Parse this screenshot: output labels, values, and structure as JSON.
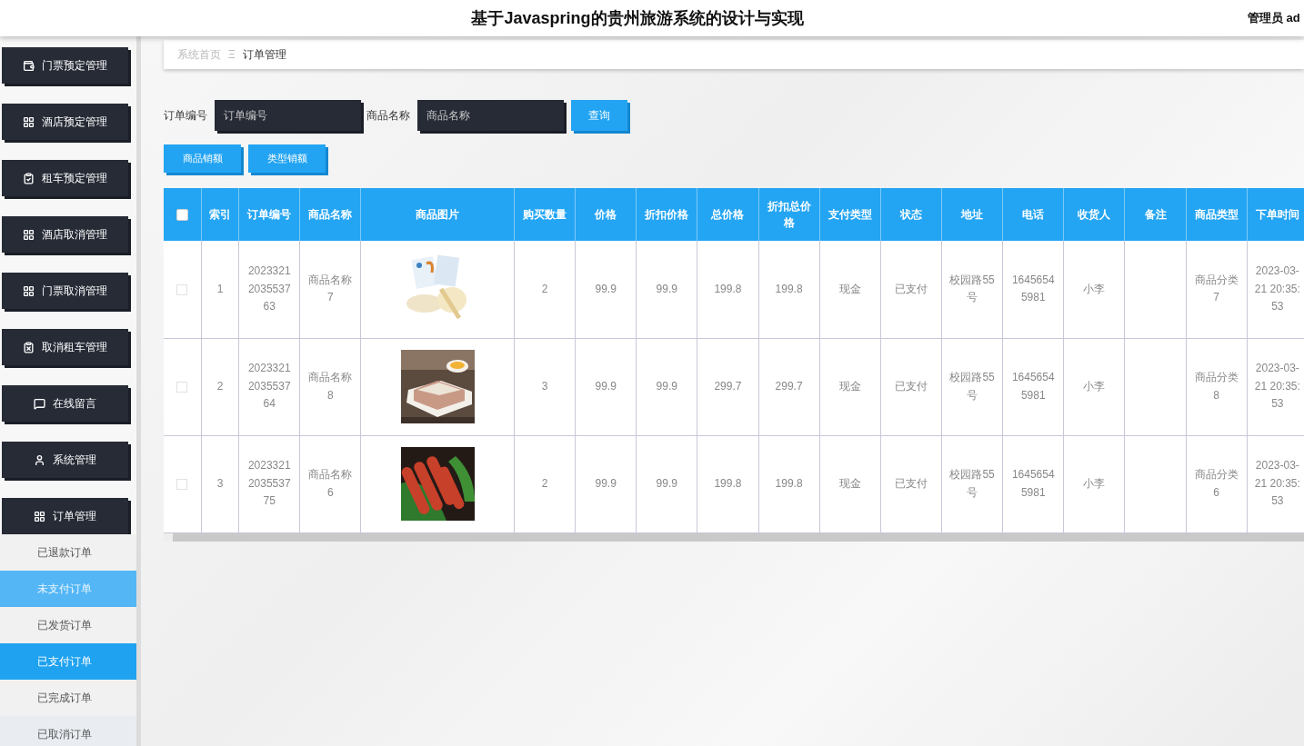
{
  "header": {
    "title": "基于Javaspring的贵州旅游系统的设计与实现",
    "user": "管理员 ad"
  },
  "sidebar": {
    "items": [
      {
        "label": "门票预定管理"
      },
      {
        "label": "酒店预定管理"
      },
      {
        "label": "租车预定管理"
      },
      {
        "label": "酒店取消管理"
      },
      {
        "label": "门票取消管理"
      },
      {
        "label": "取消租车管理"
      },
      {
        "label": "在线留言"
      },
      {
        "label": "系统管理"
      },
      {
        "label": "订单管理",
        "children": [
          {
            "label": "已退款订单",
            "selected": false,
            "hovered": false
          },
          {
            "label": "未支付订单",
            "selected": false,
            "hovered": true
          },
          {
            "label": "已发货订单",
            "selected": false,
            "hovered": false
          },
          {
            "label": "已支付订单",
            "selected": true,
            "hovered": false
          },
          {
            "label": "已完成订单",
            "selected": false,
            "hovered": false
          },
          {
            "label": "已取消订单",
            "selected": false,
            "hovered": false
          }
        ]
      }
    ]
  },
  "breadcrumb": {
    "home": "系统首页",
    "separator": "Ξ",
    "current": "订单管理"
  },
  "search": {
    "fields": [
      {
        "label": "订单编号",
        "placeholder": "订单编号"
      },
      {
        "label": "商品名称",
        "placeholder": "商品名称"
      }
    ],
    "button": "查询"
  },
  "actions": [
    "商品销额",
    "类型销额"
  ],
  "table": {
    "select_all": {
      "checked": false
    },
    "columns": [
      "索引",
      "订单编号",
      "商品名称",
      "商品图片",
      "购买数量",
      "价格",
      "折扣价格",
      "总价格",
      "折扣总价格",
      "支付类型",
      "状态",
      "地址",
      "电话",
      "收货人",
      "备注",
      "商品类型",
      "下单时间"
    ],
    "rows": [
      {
        "checked": false,
        "cells": [
          "1",
          "2023321203553763",
          "商品名称7",
          {
            "kind": "picture"
          },
          "2",
          "99.9",
          "99.9",
          "199.8",
          "199.8",
          "现金",
          "已支付",
          "校园路55号",
          "16456545981",
          "小李",
          "",
          "商品分类7",
          "2023-03-21 20:35:53"
        ]
      },
      {
        "checked": false,
        "cells": [
          "2",
          "2023321203553764",
          "商品名称8",
          {
            "kind": "picture"
          },
          "3",
          "99.9",
          "99.9",
          "299.7",
          "299.7",
          "现金",
          "已支付",
          "校园路55号",
          "16456545981",
          "小李",
          "",
          "商品分类8",
          "2023-03-21 20:35:53"
        ]
      },
      {
        "checked": false,
        "cells": [
          "3",
          "2023321203553775",
          "商品名称6",
          {
            "kind": "picture"
          },
          "2",
          "99.9",
          "99.9",
          "199.8",
          "199.8",
          "现金",
          "已支付",
          "校园路55号",
          "16456545981",
          "小李",
          "",
          "商品分类6",
          "2023-03-21 20:35:53"
        ]
      }
    ]
  }
}
